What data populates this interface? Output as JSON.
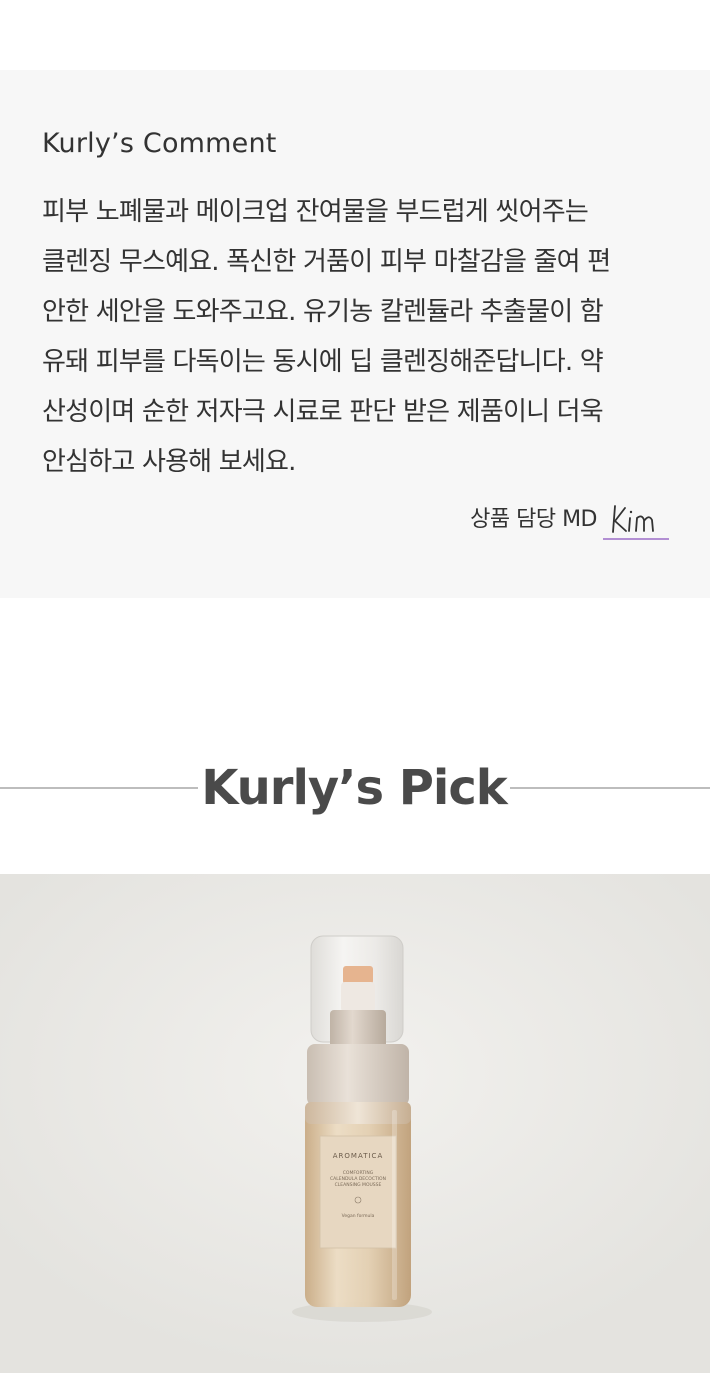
{
  "comment": {
    "title": "Kurly’s Comment",
    "lines": [
      "피부 노폐물과 메이크업 잔여물을 부드럽게 씻어주는",
      "클렌징 무스예요. 폭신한 거품이 피부 마찰감을 줄여 편",
      "안한 세안을 도와주고요. 유기농 칼렌듈라 추출물이 함",
      "유돼 피부를 다독이는 동시에 딥 클렌징해준답니다. 약",
      "산성이며 순한 저자극 시료로 판단 받은 제품이니 더욱",
      "안심하고 사용해 보세요."
    ],
    "signature_role": "상품 담당 MD",
    "signature_name": "Kim"
  },
  "pick": {
    "title": "Kurly’s Pick"
  },
  "product_photo": {
    "label_brand": "AROMATICA",
    "label_lines": [
      "COMFORTING",
      "CALENDULA DECOCTION",
      "CLEANSING MOUSSE"
    ],
    "label_footer": "Vegan formula"
  },
  "colors": {
    "comment_bg": "#f7f7f7",
    "text": "#333333",
    "signature_underline": "#b28fd3",
    "pick_title": "#4a4a4a",
    "divider": "#bdbdbd"
  }
}
